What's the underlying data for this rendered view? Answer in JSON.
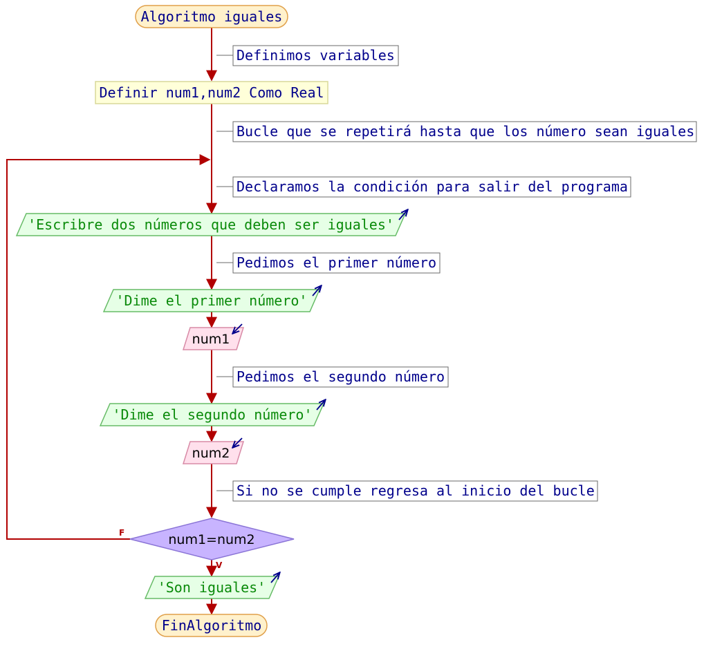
{
  "colors": {
    "flow_line": "#b10000",
    "terminal_fill": "#fff1cc",
    "terminal_stroke": "#e0a04a",
    "terminal_text": "#00008b",
    "comment_text": "#00008b",
    "comment_stroke": "#6a6a6a",
    "define_fill": "#ffffd9",
    "define_stroke": "#d9d999",
    "define_text": "#00008b",
    "output_fill": "#e6ffe6",
    "output_stroke": "#66bb66",
    "output_text": "#0a8a0a",
    "input_fill": "#ffe0ec",
    "input_stroke": "#d88aa6",
    "input_text": "#000000",
    "decision_fill": "#c8b4ff",
    "decision_stroke": "#8a74d6",
    "decision_text": "#000000",
    "io_arrow": "#00008b",
    "branch_label": "#b10000"
  },
  "diagram": {
    "start": {
      "text": "Algoritmo iguales"
    },
    "comment_variables": {
      "text": "Definimos variables"
    },
    "define": {
      "text": "Definir num1,num2 Como Real"
    },
    "comment_loop": {
      "text": "Bucle que se repetirá hasta que los número sean iguales"
    },
    "comment_condition": {
      "text": "Declaramos la condición para salir del programa"
    },
    "output_intro": {
      "text": "'Escribre dos números que deben ser iguales'",
      "icon": "output-arrow-icon"
    },
    "comment_first": {
      "text": "Pedimos el primer número"
    },
    "output_first": {
      "text": "'Dime el primer número'",
      "icon": "output-arrow-icon"
    },
    "input_num1": {
      "text": "num1",
      "icon": "input-arrow-icon"
    },
    "comment_second": {
      "text": "Pedimos el segundo número"
    },
    "output_second": {
      "text": "'Dime el segundo número'",
      "icon": "output-arrow-icon"
    },
    "input_num2": {
      "text": "num2",
      "icon": "input-arrow-icon"
    },
    "comment_back": {
      "text": "Si no se cumple regresa al inicio del bucle"
    },
    "decision": {
      "text": "num1=num2",
      "false_label": "F",
      "true_label": "V"
    },
    "output_equal": {
      "text": "'Son iguales'",
      "icon": "output-arrow-icon"
    },
    "end": {
      "text": "FinAlgoritmo"
    }
  }
}
